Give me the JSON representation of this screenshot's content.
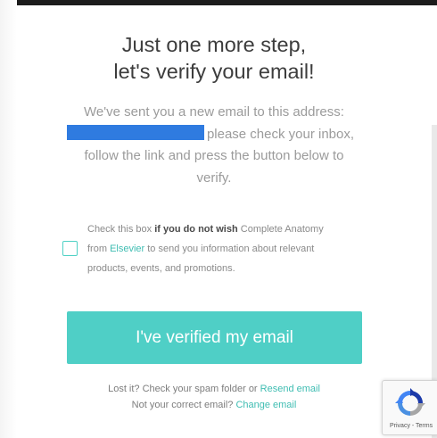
{
  "title": {
    "line1": "Just one more step,",
    "line2": "let's verify your email!"
  },
  "description": {
    "line1": "We've sent you a new email to this address:",
    "line2_after_email": "please check your inbox,",
    "line3": "follow the link and press the button below to",
    "line4": "verify."
  },
  "consent": {
    "checked": false,
    "text_before_bold": "Check this box ",
    "bold_text": "if you do not wish",
    "text_after_bold": " Complete Anatomy",
    "from_text": "from ",
    "company_link": "Elsevier",
    "text_after_link": " to send you information about relevant",
    "line3": "products, events, and promotions."
  },
  "verify_button": {
    "label": "I've verified my email"
  },
  "footer": {
    "lost_text": "Lost it? Check your spam folder or ",
    "resend_link": "Resend email",
    "wrong_text": "Not your correct email? ",
    "change_link": "Change email"
  },
  "recaptcha": {
    "privacy_terms": "Privacy - Terms"
  },
  "colors": {
    "accent": "#4fcfc6",
    "link": "#3fbdb2",
    "masked_email": "#2f7be0"
  }
}
